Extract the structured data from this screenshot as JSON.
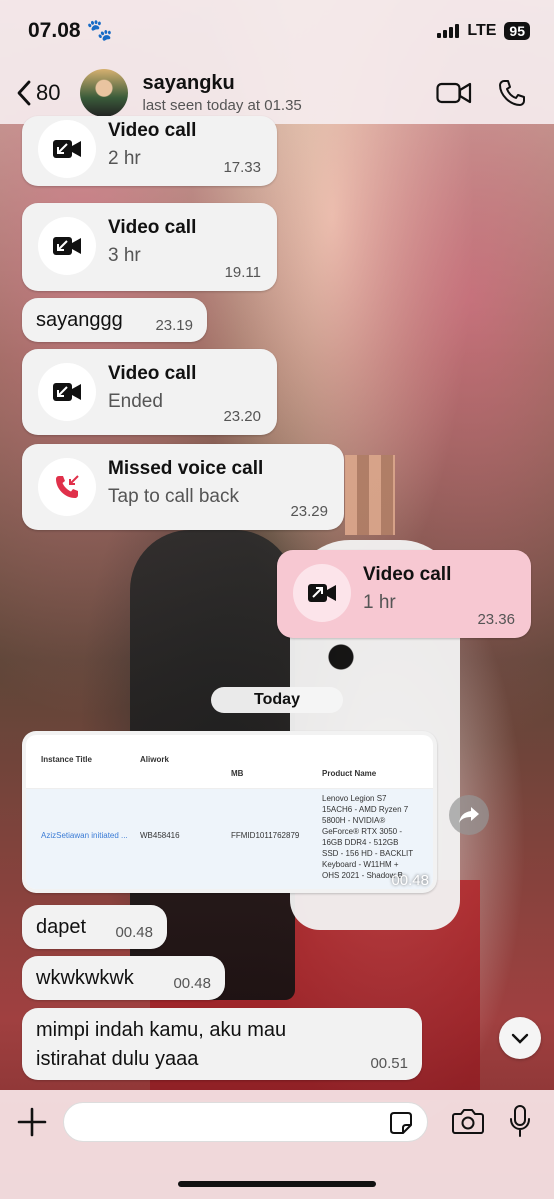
{
  "statusbar": {
    "time": "07.08",
    "network": "LTE",
    "battery": "95"
  },
  "header": {
    "back_count": "80",
    "contact_name": "sayangku",
    "contact_status": "last seen today at 01.35"
  },
  "messages": [
    {
      "type": "call",
      "direction": "in",
      "title": "Video call",
      "sub": "2 hr",
      "time": "17.33"
    },
    {
      "type": "call",
      "direction": "in",
      "title": "Video call",
      "sub": "3 hr",
      "time": "19.11"
    },
    {
      "type": "text",
      "direction": "in",
      "text": "sayanggg",
      "time": "23.19"
    },
    {
      "type": "call",
      "direction": "in",
      "title": "Video call",
      "sub": "Ended",
      "time": "23.20"
    },
    {
      "type": "call",
      "direction": "in",
      "title": "Missed voice call",
      "sub": "Tap to call back",
      "time": "23.29"
    },
    {
      "type": "call",
      "direction": "out",
      "title": "Video call",
      "sub": "1 hr",
      "time": "23.36"
    },
    {
      "type": "text",
      "direction": "in",
      "text": "dapet",
      "time": "00.48"
    },
    {
      "type": "text",
      "direction": "in",
      "text": "wkwkwkwk",
      "time": "00.48"
    },
    {
      "type": "text",
      "direction": "in",
      "text": "mimpi indah kamu, aku mau istirahat dulu yaaa",
      "time": "00.51"
    }
  ],
  "date_divider": "Today",
  "image_message": {
    "time": "00.48",
    "table": {
      "headers": [
        "Instance Title",
        "Aliwork",
        "MB",
        "Product Name"
      ],
      "row": [
        "AzizSetiawan initiated ...",
        "WB458416",
        "FFMID1011762879",
        "Lenovo Legion S7 15ACH6 - AMD Ryzen 7 5800H - NVIDIA® GeForce® RTX 3050 - 16GB DDR4 - 512GB SSD - 156 HD - BACKLIT Keyboard - W11HM + OHS 2021 - Shadow B"
      ]
    }
  },
  "input": {
    "placeholder": ""
  },
  "colors": {
    "incoming": "#f2f2f2",
    "outgoing": "#f7c8d2",
    "missed": "#e0304a"
  }
}
